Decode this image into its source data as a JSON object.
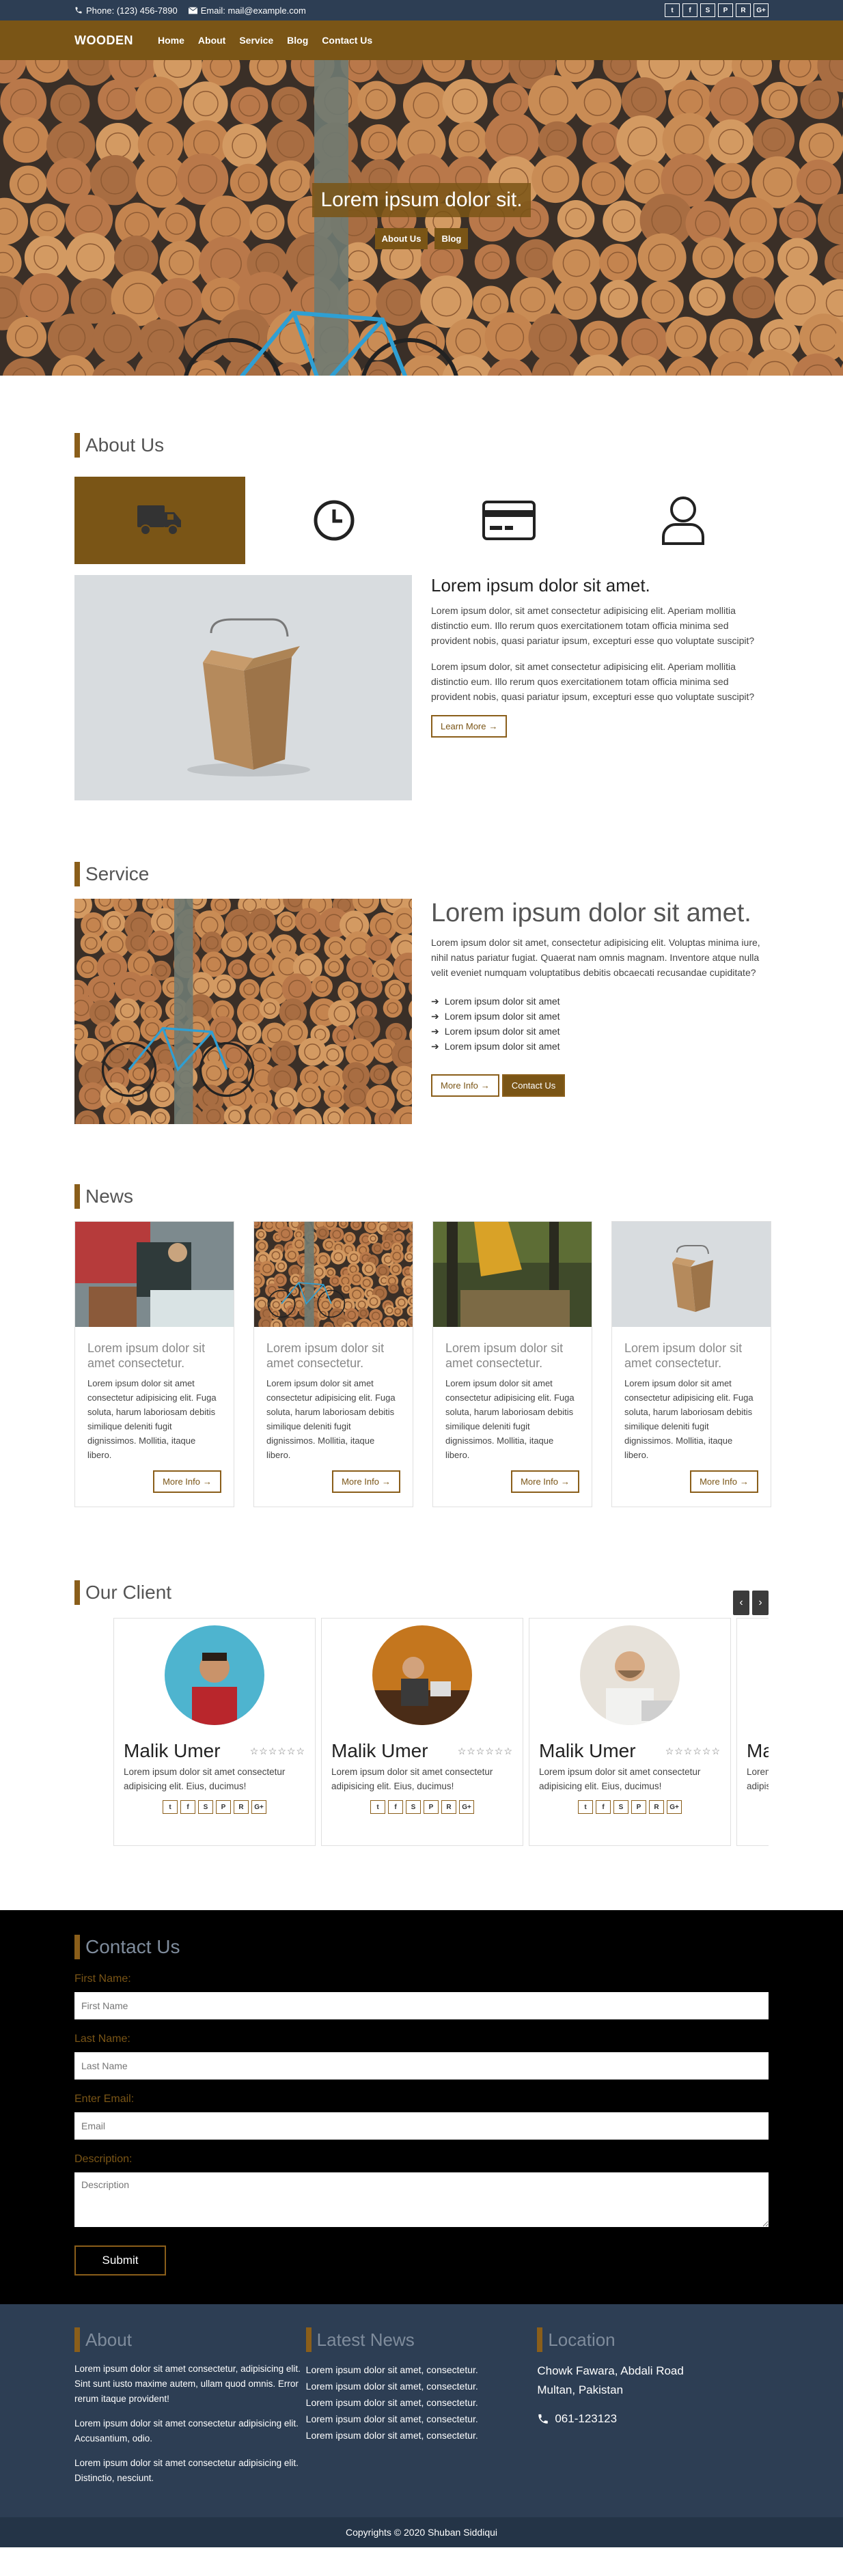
{
  "topbar": {
    "phone": "Phone: (123) 456-7890",
    "email": "Email: mail@example.com",
    "social": [
      "twitter-icon",
      "facebook-icon",
      "skype-icon",
      "pinterest-icon",
      "rss-icon",
      "google-plus-icon"
    ],
    "social_glyphs": [
      "t",
      "f",
      "S",
      "P",
      "R",
      "G+"
    ]
  },
  "nav": {
    "brand": "WOODEN",
    "links": [
      "Home",
      "About",
      "Service",
      "Blog",
      "Contact Us"
    ]
  },
  "hero": {
    "title": "Lorem ipsum dolor sit.",
    "btn_about": "About Us",
    "btn_blog": "Blog"
  },
  "about": {
    "title": "About Us",
    "features": [
      "truck-icon",
      "clock-icon",
      "credit-card-icon",
      "user-icon"
    ],
    "heading": "Lorem ipsum dolor sit amet.",
    "para1": "Lorem ipsum dolor, sit amet consectetur adipisicing elit. Aperiam mollitia distinctio eum. Illo rerum quos exercitationem totam officia minima sed provident nobis, quasi pariatur ipsum, excepturi esse quo voluptate suscipit?",
    "para2": "Lorem ipsum dolor, sit amet consectetur adipisicing elit. Aperiam mollitia distinctio eum. Illo rerum quos exercitationem totam officia minima sed provident nobis, quasi pariatur ipsum, excepturi esse quo voluptate suscipit?",
    "learn_more": "Learn More"
  },
  "service": {
    "title": "Service",
    "heading": "Lorem ipsum dolor sit amet.",
    "para": "Lorem ipsum dolor sit amet, consectetur adipisicing elit. Voluptas minima iure, nihil natus pariatur fugiat. Quaerat nam omnis magnam. Inventore atque nulla velit eveniet numquam voluptatibus debitis obcaecati recusandae cupiditate?",
    "list": [
      "Lorem ipsum dolor sit amet",
      "Lorem ipsum dolor sit amet",
      "Lorem ipsum dolor sit amet",
      "Lorem ipsum dolor sit amet"
    ],
    "more_info": "More Info",
    "contact_us": "Contact Us"
  },
  "news": {
    "title": "News",
    "cards": [
      {
        "heading": "Lorem ipsum dolor sit amet consectetur.",
        "text": "Lorem ipsum dolor sit amet consectetur adipisicing elit. Fuga soluta, harum laboriosam debitis similique deleniti fugit dignissimos. Mollitia, itaque libero.",
        "button": "More Info"
      },
      {
        "heading": "Lorem ipsum dolor sit amet consectetur.",
        "text": "Lorem ipsum dolor sit amet consectetur adipisicing elit. Fuga soluta, harum laboriosam debitis similique deleniti fugit dignissimos. Mollitia, itaque libero.",
        "button": "More Info"
      },
      {
        "heading": "Lorem ipsum dolor sit amet consectetur.",
        "text": "Lorem ipsum dolor sit amet consectetur adipisicing elit. Fuga soluta, harum laboriosam debitis similique deleniti fugit dignissimos. Mollitia, itaque libero.",
        "button": "More Info"
      },
      {
        "heading": "Lorem ipsum dolor sit amet consectetur.",
        "text": "Lorem ipsum dolor sit amet consectetur adipisicing elit. Fuga soluta, harum laboriosam debitis similique deleniti fugit dignissimos. Mollitia, itaque libero.",
        "button": "More Info"
      }
    ]
  },
  "clients": {
    "title": "Our Client",
    "prev": "‹",
    "next": "›",
    "items": [
      {
        "name": "Malik Umer",
        "stars": "☆☆☆☆☆☆",
        "text": "Lorem ipsum dolor sit amet consectetur adipisicing elit. Eius, ducimus!"
      },
      {
        "name": "Malik Umer",
        "stars": "☆☆☆☆☆☆",
        "text": "Lorem ipsum dolor sit amet consectetur adipisicing elit. Eius, ducimus!"
      },
      {
        "name": "Malik Umer",
        "stars": "☆☆☆☆☆☆",
        "text": "Lorem ipsum dolor sit amet consectetur adipisicing elit. Eius, ducimus!"
      },
      {
        "name": "Malik Umer",
        "stars": "☆☆☆☆☆☆",
        "text": "Lorem ipsum dolor sit amet consectetur adipisicing elit. Eius, ducimus!"
      }
    ]
  },
  "contact": {
    "title": "Contact Us",
    "first_label": "First Name:",
    "first_placeholder": "First Name",
    "last_label": "Last Name:",
    "last_placeholder": "Last Name",
    "email_label": "Enter Email:",
    "email_placeholder": "Email",
    "desc_label": "Description:",
    "desc_placeholder": "Description",
    "submit": "Submit"
  },
  "footer": {
    "about_title": "About",
    "about_p1": "Lorem ipsum dolor sit amet consectetur, adipisicing elit. Sint sunt iusto maxime autem, ullam quod omnis. Error rerum itaque provident!",
    "about_p2": "Lorem ipsum dolor sit amet consectetur adipisicing elit. Accusantium, odio.",
    "about_p3": "Lorem ipsum dolor sit amet consectetur adipisicing elit. Distinctio, nesciunt.",
    "news_title": "Latest News",
    "news_items": [
      "Lorem ipsum dolor sit amet, consectetur.",
      "Lorem ipsum dolor sit amet, consectetur.",
      "Lorem ipsum dolor sit amet, consectetur.",
      "Lorem ipsum dolor sit amet, consectetur.",
      "Lorem ipsum dolor sit amet, consectetur."
    ],
    "location_title": "Location",
    "address1": "Chowk Fawara, Abdali Road",
    "address2": "Multan, Pakistan",
    "phone": "061-123123",
    "copyright": "Copyrights © 2020 Shuban Siddiqui"
  },
  "colors": {
    "brand_brown": "#7a5516",
    "navy": "#2d3e54",
    "black": "#000000"
  }
}
